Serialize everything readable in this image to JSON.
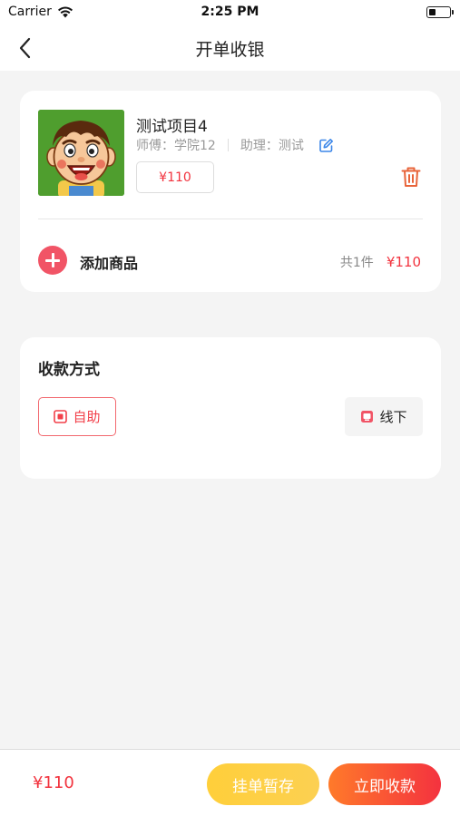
{
  "status_bar": {
    "carrier": "Carrier",
    "time": "2:25 PM",
    "battery_level": 0.35
  },
  "nav": {
    "title": "开单收银",
    "back_icon": "chevron-left-icon"
  },
  "order": {
    "product": {
      "name": "测试项目4",
      "master": "师傅：学院12",
      "assistant": "助理：测试",
      "price": "¥110",
      "image_icon": "cartoon-boy-avatar",
      "edit_icon": "edit-icon",
      "delete_icon": "trash-icon"
    },
    "add_label": "添加商品",
    "count_text": "共1件",
    "total": "¥110"
  },
  "payment": {
    "title": "收款方式",
    "options": [
      {
        "label": "自助",
        "selected": true,
        "icon": "self-service-icon"
      },
      {
        "label": "线下",
        "selected": false,
        "icon": "offline-icon"
      }
    ]
  },
  "footer": {
    "total": "¥110",
    "hold_label": "挂单暂存",
    "pay_label": "立即收款"
  },
  "colors": {
    "accent_red": "#f2333e",
    "add_button": "#f15466",
    "hold_button": "#ffcf3a",
    "pay_button_start": "#ff7a2a",
    "pay_button_end": "#f4323f",
    "edit_blue": "#3b86e8",
    "trash_orange": "#e8643a"
  }
}
